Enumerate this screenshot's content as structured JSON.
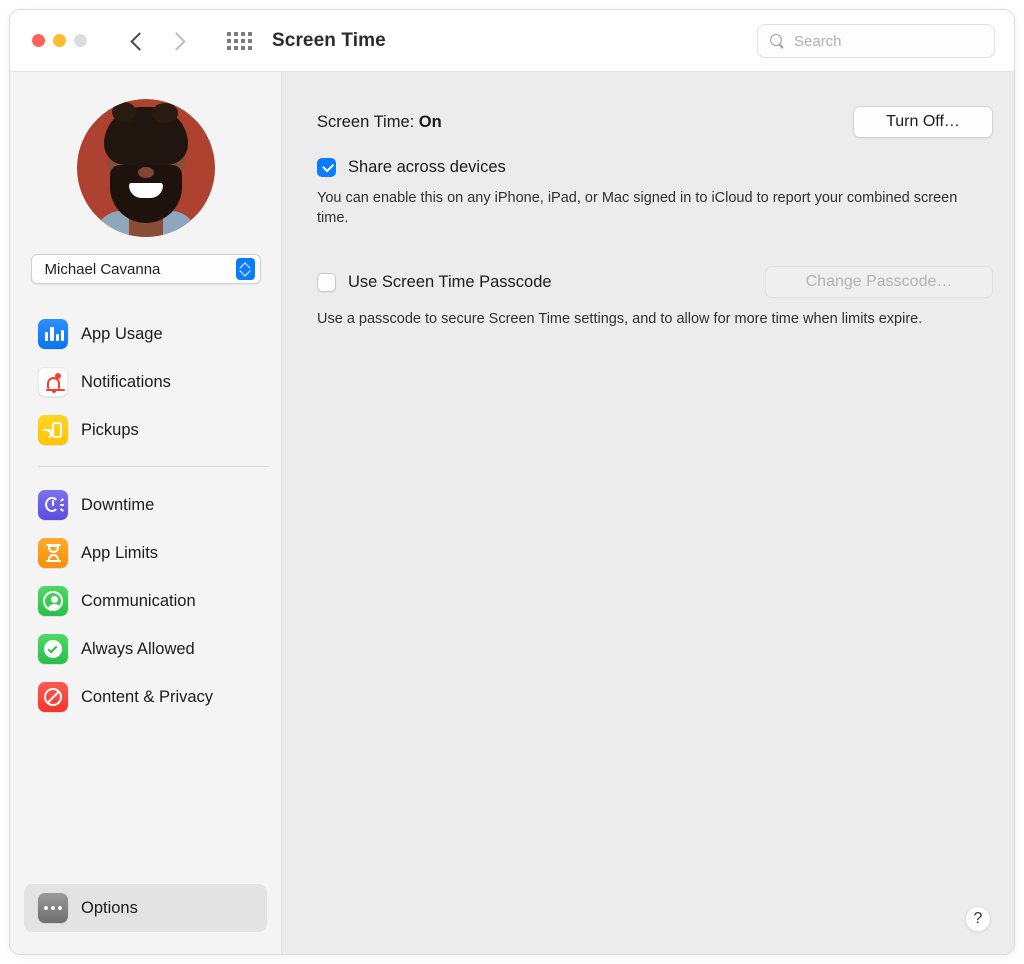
{
  "window": {
    "title": "Screen Time",
    "traffic_lights": [
      "close",
      "minimize",
      "zoom"
    ],
    "back_icon": "chevron-left-icon",
    "forward_icon": "chevron-right-icon",
    "grid_icon": "show-all-grid-icon"
  },
  "search": {
    "placeholder": "Search",
    "value": "",
    "icon": "search-icon"
  },
  "sidebar": {
    "avatar_alt": "user-profile-photo",
    "user_name": "Michael Cavanna",
    "groups": [
      {
        "items": [
          {
            "label": "App Usage",
            "icon": "bar-chart-icon",
            "selected": false
          },
          {
            "label": "Notifications",
            "icon": "bell-icon",
            "selected": false
          },
          {
            "label": "Pickups",
            "icon": "phone-pickup-icon",
            "selected": false
          }
        ]
      },
      {
        "items": [
          {
            "label": "Downtime",
            "icon": "moon-clock-icon",
            "selected": false
          },
          {
            "label": "App Limits",
            "icon": "hourglass-icon",
            "selected": false
          },
          {
            "label": "Communication",
            "icon": "person-circle-icon",
            "selected": false
          },
          {
            "label": "Always Allowed",
            "icon": "check-badge-icon",
            "selected": false
          },
          {
            "label": "Content & Privacy",
            "icon": "prohibition-icon",
            "selected": false
          }
        ]
      }
    ],
    "options": {
      "label": "Options",
      "icon": "ellipsis-icon",
      "selected": true
    }
  },
  "main": {
    "status_prefix": "Screen Time: ",
    "status_value": "On",
    "turn_off_label": "Turn Off…",
    "share": {
      "label": "Share across devices",
      "checked": true,
      "description": "You can enable this on any iPhone, iPad, or Mac signed in to iCloud to report your combined screen time."
    },
    "passcode": {
      "label": "Use Screen Time Passcode",
      "checked": false,
      "button_label": "Change Passcode…",
      "button_enabled": false,
      "description": "Use a passcode to secure Screen Time settings, and to allow for more time when limits expire."
    },
    "help_label": "?"
  },
  "colors": {
    "accent_blue": "#0a7cff",
    "sidebar_bg": "#f4f4f4",
    "content_bg": "#ececec",
    "titlebar_bg": "#ffffff",
    "selected_row": "#e3e3e3",
    "disabled_text": "#b3b3b3"
  }
}
